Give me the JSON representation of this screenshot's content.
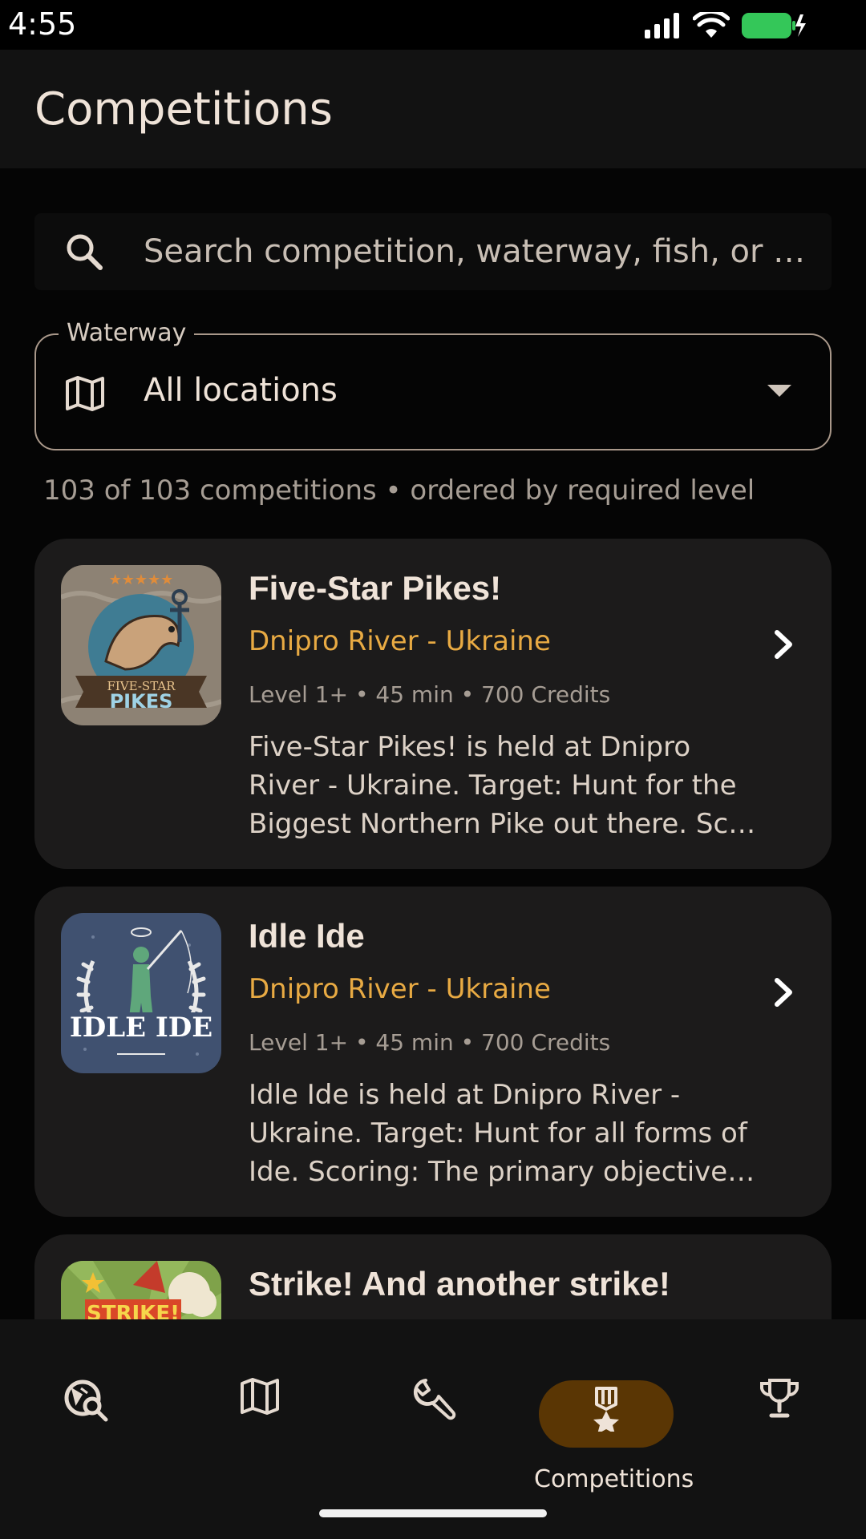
{
  "status_bar": {
    "time": "4:55"
  },
  "app_bar": {
    "title": "Competitions"
  },
  "search": {
    "placeholder": "Search competition, waterway, fish, or r…"
  },
  "waterway_filter": {
    "label": "Waterway",
    "value": "All locations"
  },
  "result_summary": "103 of 103 competitions • ordered by required level",
  "competitions": [
    {
      "title": "Five-Star Pikes!",
      "location": "Dnipro River - Ukraine",
      "meta": "Level 1+ • 45 min • 700 Credits",
      "description": "Five-Star Pikes! is held at Dnipro River - Ukraine. Target: Hunt for the Biggest Northern Pike out there. Sc…",
      "badge_line1": "FIVE-STAR",
      "badge_line2": "PIKES"
    },
    {
      "title": "Idle Ide",
      "location": "Dnipro River - Ukraine",
      "meta": "Level 1+ • 45 min • 700 Credits",
      "description": "Idle Ide is held at Dnipro River - Ukraine. Target: Hunt for all forms of Ide. Scoring: The primary objective i…",
      "badge_line1": "IDLE IDE"
    },
    {
      "title": "Strike! And another strike!",
      "badge_line1": "STRIKE!"
    }
  ],
  "bottom_nav": {
    "items": [
      {
        "icon": "explore-search-icon"
      },
      {
        "icon": "map-icon"
      },
      {
        "icon": "wrench-icon"
      },
      {
        "icon": "medal-icon",
        "label": "Competitions",
        "active": true
      },
      {
        "icon": "trophy-icon"
      }
    ]
  },
  "colors": {
    "accent": "#E8AA43",
    "active_pill": "#5A3604",
    "card_bg": "#1C1B1B",
    "background": "#050505"
  }
}
